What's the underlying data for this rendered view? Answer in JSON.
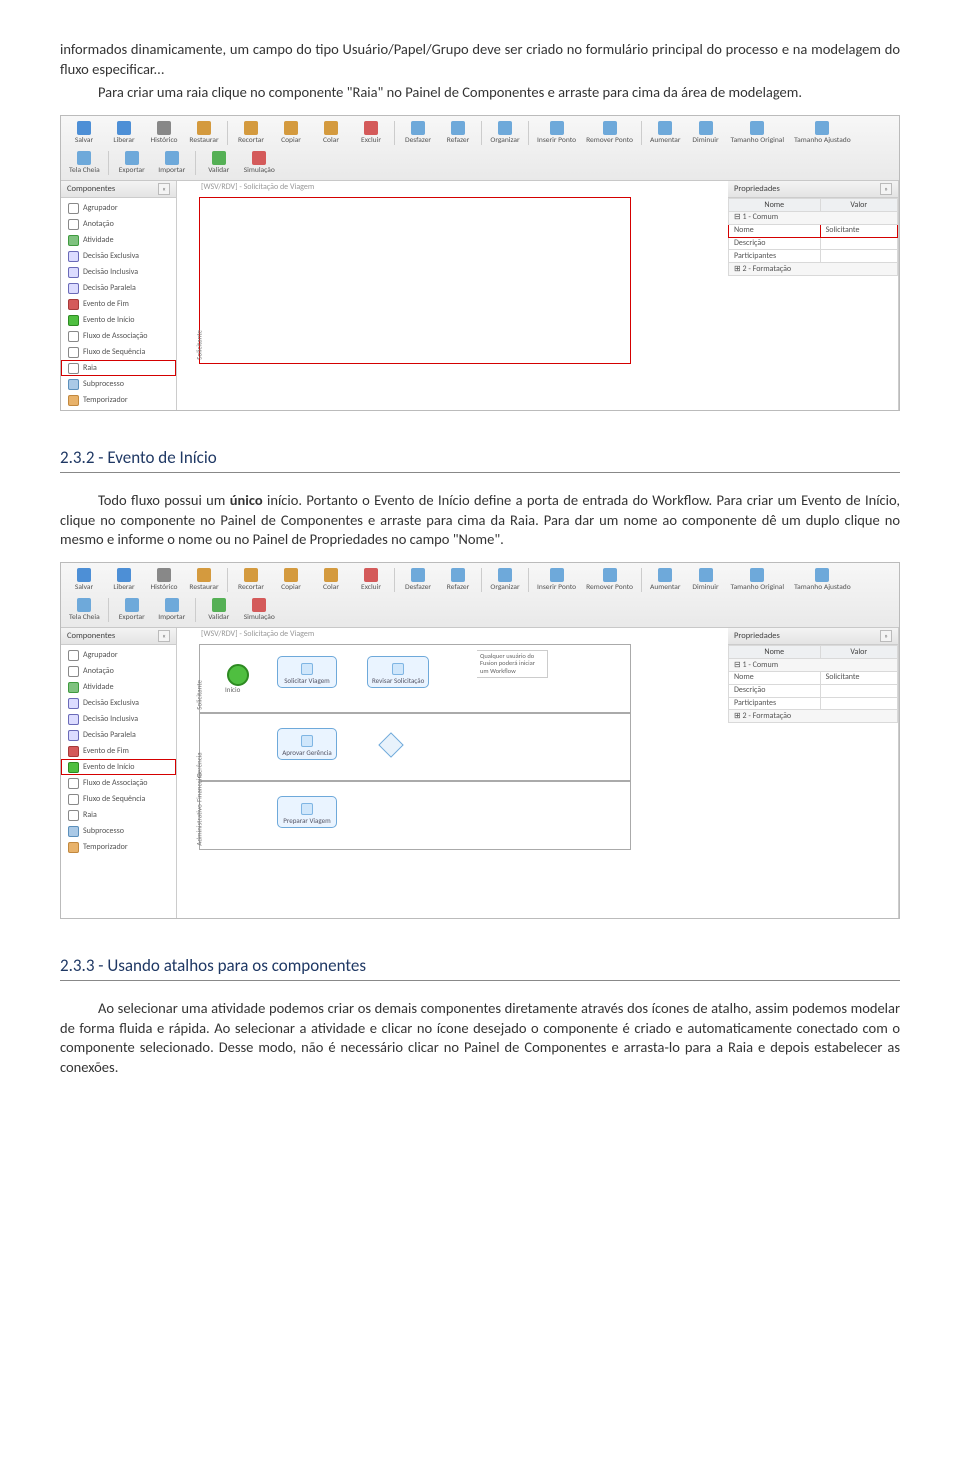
{
  "para1_a": "informados dinamicamente, um campo do tipo Usuário/Papel/Grupo deve ser criado no formulário principal do processo e na modelagem do fluxo especificar...",
  "para1_b": "Para criar uma raia clique no componente \"Raia\" no Painel de Componentes e arraste para cima da área de modelagem.",
  "h232": "2.3.2 - Evento de Início",
  "para2": "Todo fluxo possui um único início. Portanto o Evento de Início define a porta de entrada do Workflow. Para criar um Evento de Início, clique no componente no Painel de Componentes e arraste para cima da Raia. Para dar um nome ao componente dê um duplo clique no mesmo e informe o nome ou no Painel de Propriedades no campo \"Nome\".",
  "bold_unico": "único",
  "h233": "2.3.3 - Usando atalhos para os componentes",
  "para3": "Ao selecionar uma atividade podemos criar os demais componentes diretamente através dos ícones de atalho, assim podemos modelar de forma fluida e rápida. Ao selecionar a atividade e clicar no ícone desejado o componente é criado e automaticamente conectado com o componente selecionado. Desse modo, não é necessário clicar no Painel de Componentes e arrasta-lo para a Raia e depois estabelecer as conexões.",
  "toolbar": [
    "Salvar",
    "Liberar",
    "Histórico",
    "Restaurar",
    "Recortar",
    "Copiar",
    "Colar",
    "Excluir",
    "Desfazer",
    "Refazer",
    "Organizar",
    "Inserir Ponto",
    "Remover Ponto",
    "Aumentar",
    "Diminuir",
    "Tamanho Original",
    "Tamanho Ajustado",
    "Tela Cheia",
    "Exportar",
    "Importar",
    "Validar",
    "Simulação"
  ],
  "componentes_title": "Componentes",
  "componentes": [
    {
      "label": "Agrupador",
      "c": "#ffffff",
      "b": "#888"
    },
    {
      "label": "Anotação",
      "c": "#ffffff",
      "b": "#888"
    },
    {
      "label": "Atividade",
      "c": "#7fc27f",
      "b": "#3f9a3f"
    },
    {
      "label": "Decisão Exclusiva",
      "c": "#dcdcff",
      "b": "#6a6ab8"
    },
    {
      "label": "Decisão Inclusiva",
      "c": "#dcdcff",
      "b": "#6a6ab8"
    },
    {
      "label": "Decisão Paralela",
      "c": "#dcdcff",
      "b": "#6a6ab8"
    },
    {
      "label": "Evento de Fim",
      "c": "#d45a5a",
      "b": "#a63a3a"
    },
    {
      "label": "Evento de Início",
      "c": "#4fbf40",
      "b": "#2d8a22"
    },
    {
      "label": "Fluxo de Associação",
      "c": "#ffffff",
      "b": "#888"
    },
    {
      "label": "Fluxo de Sequência",
      "c": "#ffffff",
      "b": "#888"
    },
    {
      "label": "Raia",
      "c": "#ffffff",
      "b": "#888"
    },
    {
      "label": "Subprocesso",
      "c": "#aac9e6",
      "b": "#5b8fbb"
    },
    {
      "label": "Temporizador",
      "c": "#e8b26a",
      "b": "#c2883e"
    }
  ],
  "props_title": "Propriedades",
  "props_h1": "Nome",
  "props_h2": "Valor",
  "props_g1": "1 - Comum",
  "props_nome_k": "Nome",
  "props_nome_v": "Solicitante",
  "props_desc": "Descrição",
  "props_part": "Participantes",
  "props_g2": "2 - Formatação",
  "canvas_tab": "[WSV/RDV] - Solicitação de Viagem",
  "lane1": "Solicitante",
  "act_inicio": "Início",
  "act_solicitar": "Solicitar Viagem",
  "act_revisar": "Revisar Solicitação",
  "lane2": "Gerência",
  "act_aprovar": "Aprovar Gerência",
  "lane3": "Administrativo-Financeiro",
  "act_preparar": "Preparar Viagem",
  "note_txt": "Qualquer usuário do Fusion poderá iniciar um Workflow",
  "hl1_index": 10,
  "hl2_index": 7
}
